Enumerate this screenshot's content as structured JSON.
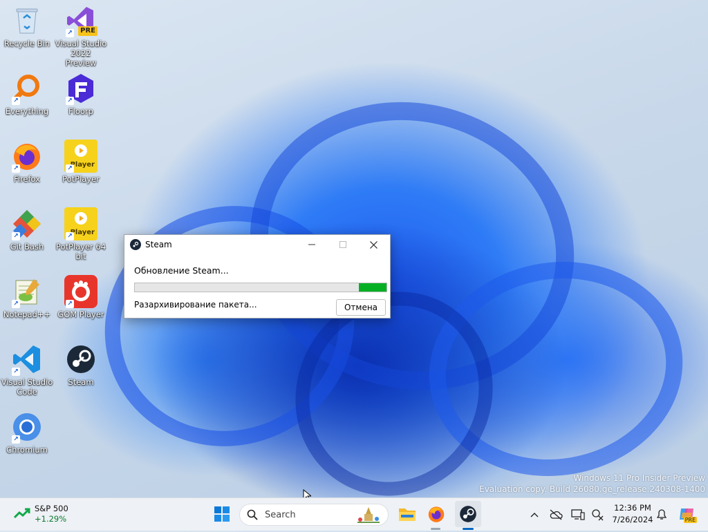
{
  "desktop_icons": [
    {
      "label": "Recycle Bin",
      "icon": "recycle-bin-icon"
    },
    {
      "label": "Visual Studio 2022 Preview",
      "badge": "PRE",
      "icon": "visual-studio-icon"
    },
    {
      "label": "Everything",
      "icon": "everything-search-icon"
    },
    {
      "label": "Floorp",
      "icon": "floorp-icon"
    },
    {
      "label": "Firefox",
      "icon": "firefox-icon"
    },
    {
      "label": "PotPlayer",
      "badge": "Player",
      "icon": "potplayer-icon"
    },
    {
      "label": "Git Bash",
      "icon": "git-bash-icon"
    },
    {
      "label": "PotPlayer 64 bit",
      "badge": "Player",
      "icon": "potplayer64-icon"
    },
    {
      "label": "Notepad++",
      "icon": "notepadpp-icon"
    },
    {
      "label": "GOM Player",
      "icon": "gom-player-icon"
    },
    {
      "label": "Visual Studio Code",
      "icon": "vscode-icon"
    },
    {
      "label": "Steam",
      "icon": "steam-icon"
    },
    {
      "label": "Chromium",
      "icon": "chromium-icon"
    }
  ],
  "dialog": {
    "title": "Steam",
    "status": "Обновление Steam...",
    "progress": 0.11,
    "sub_status": "Разархивирование пакета...",
    "cancel_label": "Отмена"
  },
  "watermark": {
    "line1": "Windows 11 Pro Insider Preview",
    "line2": "Evaluation copy. Build 26080.ge_release.240308-1400"
  },
  "taskbar": {
    "stock_name": "S&P 500",
    "stock_change": "+1.29%",
    "search_placeholder": "Search",
    "time": "12:36 PM",
    "date": "7/26/2024",
    "copilot_badge": "PRE"
  },
  "colors": {
    "progress_fill": "#06b025",
    "stock_positive": "#0a7a2f",
    "accent": "#0067c0"
  }
}
